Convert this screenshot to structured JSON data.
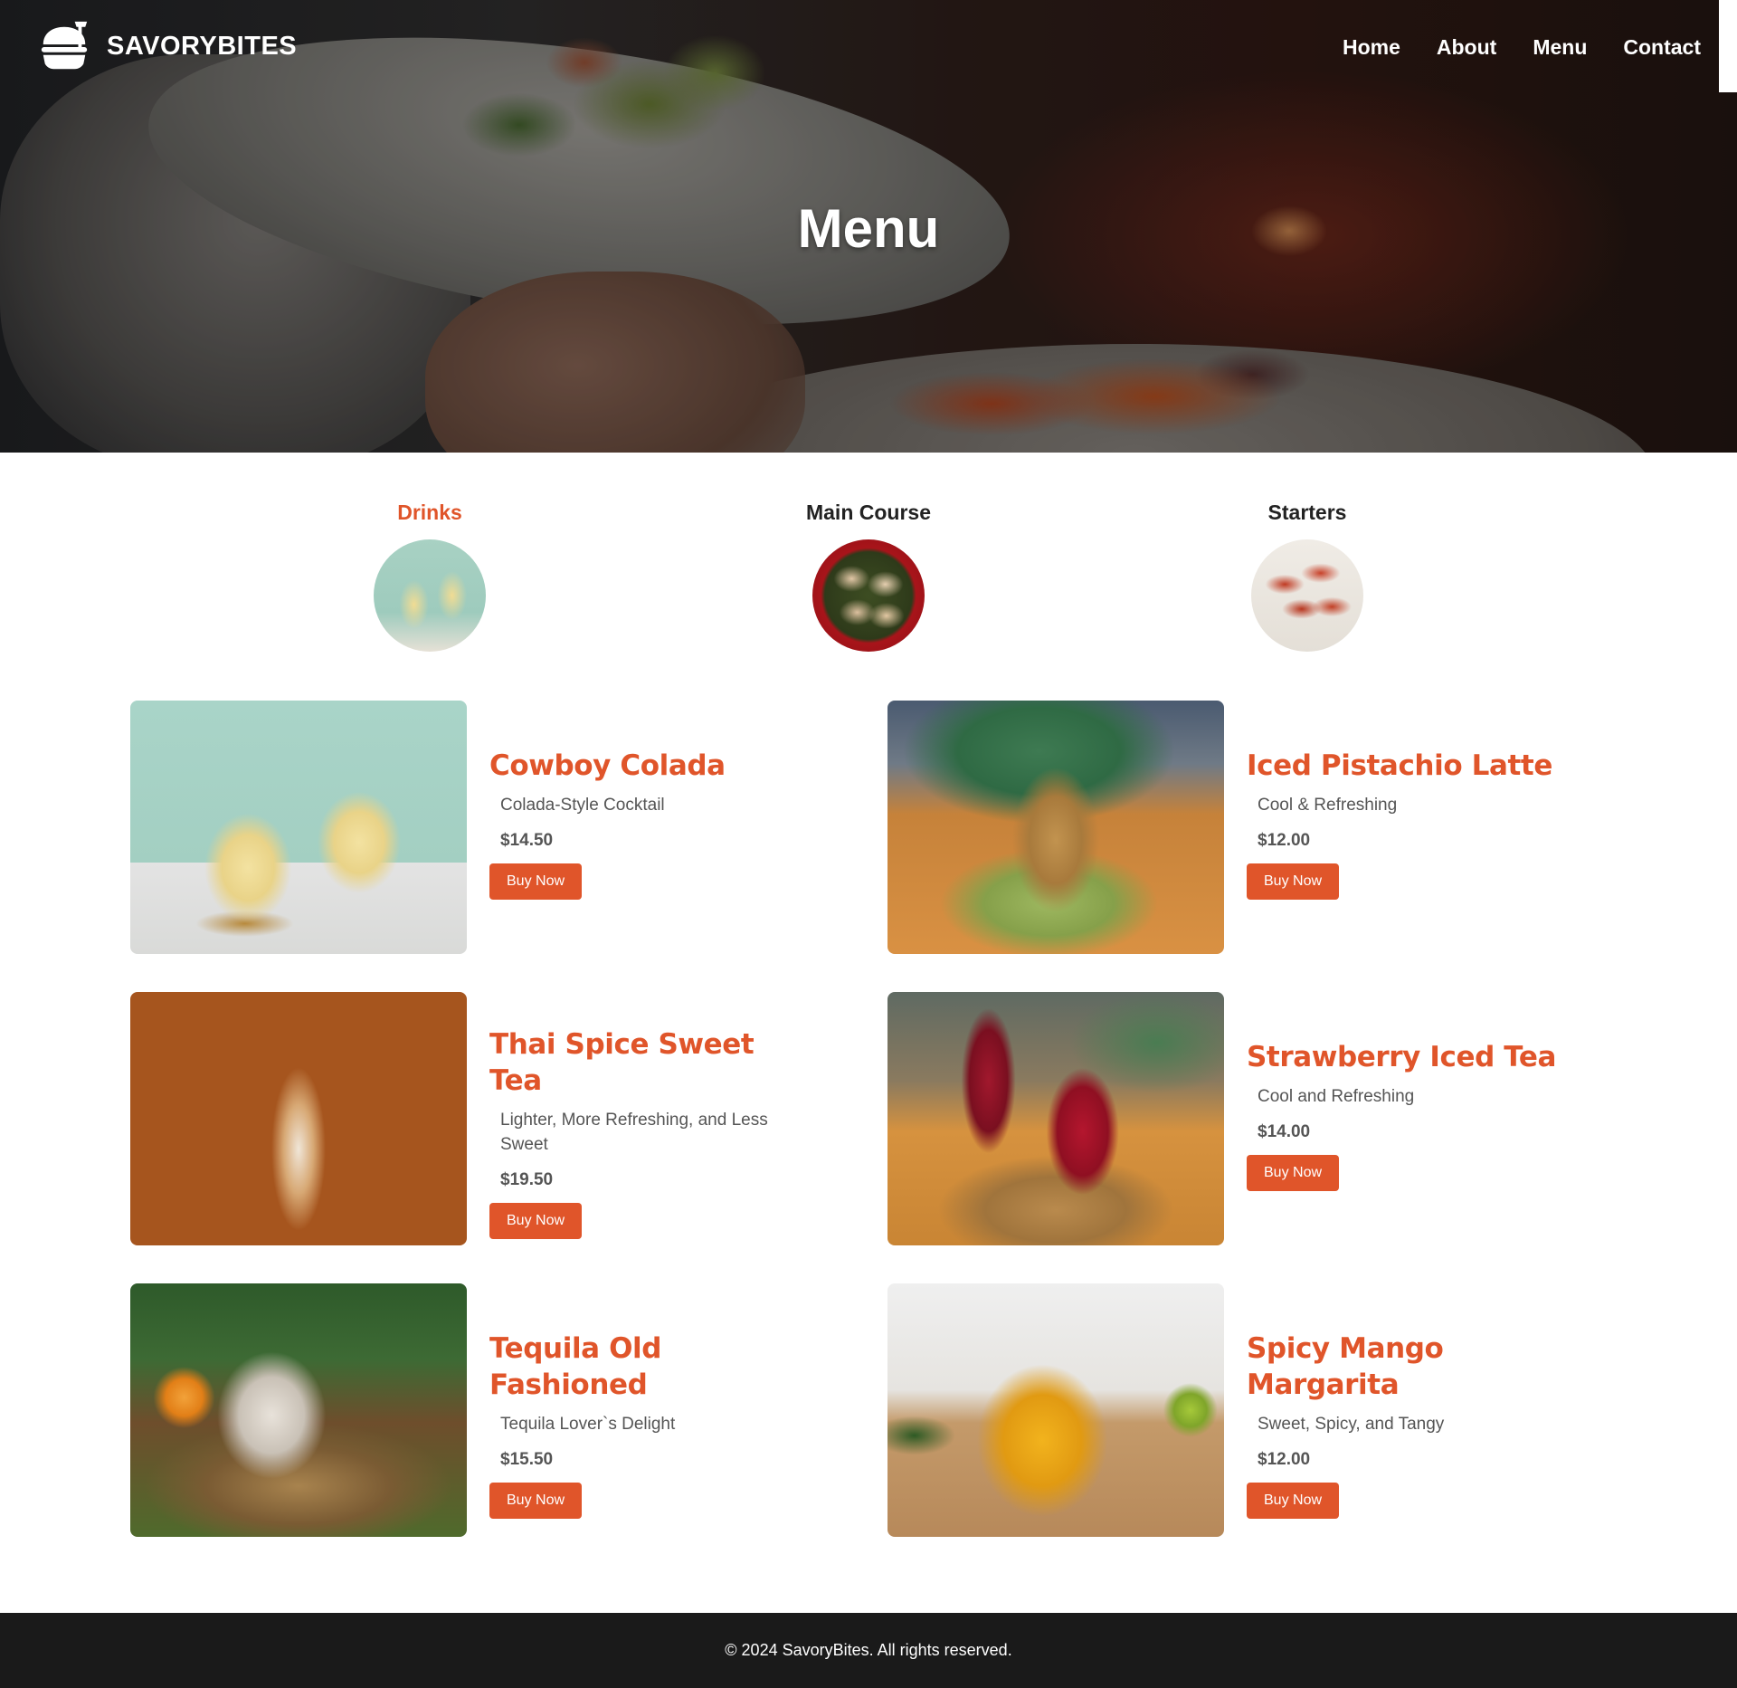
{
  "brand": {
    "name": "SAVORYBITES",
    "logo_icon": "burger-dome-icon"
  },
  "nav": {
    "items": [
      "Home",
      "About",
      "Menu",
      "Contact"
    ]
  },
  "hero": {
    "title": "Menu"
  },
  "categories": [
    {
      "label": "Drinks",
      "active": true
    },
    {
      "label": "Main Course",
      "active": false
    },
    {
      "label": "Starters",
      "active": false
    }
  ],
  "menu": {
    "items": [
      {
        "name": "Cowboy Colada",
        "desc": "Colada-Style Cocktail",
        "price": "$14.50",
        "cta": "Buy Now"
      },
      {
        "name": "Iced Pistachio Latte",
        "desc": "Cool & Refreshing",
        "price": "$12.00",
        "cta": "Buy Now"
      },
      {
        "name": "Thai Spice Sweet Tea",
        "desc": "Lighter, More Refreshing, and Less Sweet",
        "price": "$19.50",
        "cta": "Buy Now"
      },
      {
        "name": "Strawberry Iced Tea",
        "desc": "Cool and Refreshing",
        "price": "$14.00",
        "cta": "Buy Now"
      },
      {
        "name": "Tequila Old Fashioned",
        "desc": "Tequila Lover`s Delight",
        "price": "$15.50",
        "cta": "Buy Now"
      },
      {
        "name": "Spicy Mango Margarita",
        "desc": "Sweet, Spicy, and Tangy",
        "price": "$12.00",
        "cta": "Buy Now"
      }
    ]
  },
  "footer": {
    "text": "© 2024 SavoryBites. All rights reserved."
  },
  "colors": {
    "accent": "#e0552a",
    "footer_bg": "#1a1a1a",
    "text_muted": "#555555"
  }
}
